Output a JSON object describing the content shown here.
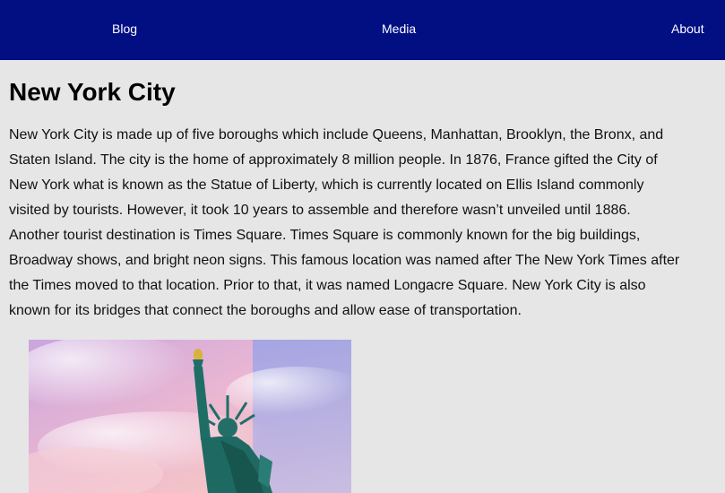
{
  "nav": {
    "items": [
      {
        "label": "Blog"
      },
      {
        "label": "Media"
      },
      {
        "label": "About"
      }
    ]
  },
  "main": {
    "title": "New York City",
    "paragraph": "New York City is made up of five boroughs which include Queens, Manhattan, Brooklyn, the Bronx, and Staten Island. The city is the home of approximately 8 million people. In 1876, France gifted the City of New York what is known as the Statue of Liberty, which is currently located on Ellis Island commonly visited by tourists. However, it took 10 years to assemble and therefore wasn’t unveiled until 1886. Another tourist destination is Times Square. Times Square is commonly known for the big buildings, Broadway shows, and bright neon signs. This famous location was named after The New York Times after the Times moved to that location. Prior to that, it was named Longacre Square. New York City is also known for its bridges that connect the boroughs and allow ease of transportation."
  },
  "colors": {
    "navbar_bg": "#010f83",
    "page_bg": "#e6e6e6",
    "statue": "#1f6e66"
  }
}
